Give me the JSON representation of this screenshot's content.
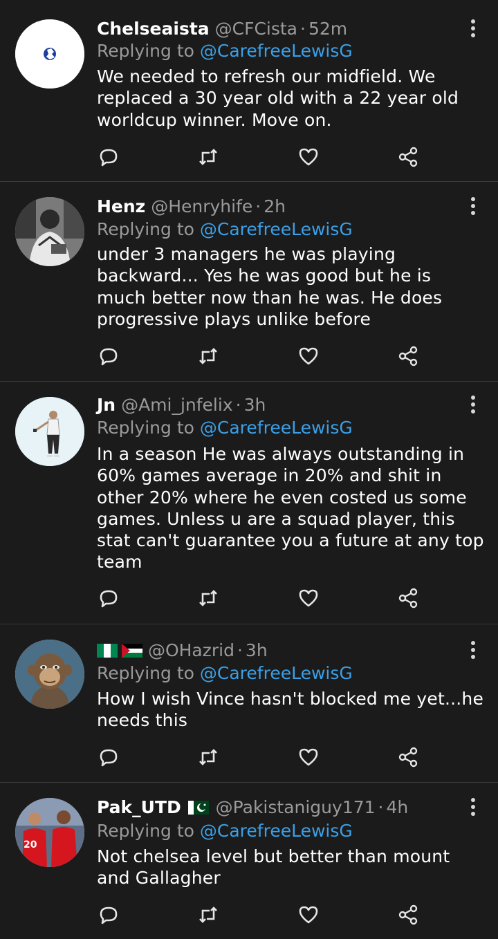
{
  "reply_prefix": "Replying to",
  "tweets": [
    {
      "name": "Chelseaista",
      "handle": "@CFCista",
      "time": "52m",
      "replying_to": "@CarefreeLewisG",
      "text": "We needed to refresh our midfield. We replaced a 30 year old with a 22 year old worldcup winner. Move on.",
      "avatar": "chelsea-crest"
    },
    {
      "name": "Henz",
      "handle": "@Henryhife",
      "time": "2h",
      "replying_to": "@CarefreeLewisG",
      "text": "under 3 managers he was playing backward... Yes he was good but he is much better now than he was.  He does progressive plays unlike before",
      "avatar": "person-photo"
    },
    {
      "name": "Jn",
      "handle": "@Ami_jnfelix",
      "time": "3h",
      "replying_to": "@CarefreeLewisG",
      "text": "In a season He was always outstanding in 60% games average in 20% and shit in other 20% where he even costed us some games. Unless u are a squad player, this stat can't guarantee you a future at any top team",
      "avatar": "player-illustration"
    },
    {
      "name": "",
      "name_flags": [
        "nigeria-flag",
        "palestine-flag"
      ],
      "handle": "@OHazrid",
      "time": "3h",
      "replying_to": "@CarefreeLewisG",
      "text": "How I wish Vince hasn't blocked me yet...he needs this",
      "avatar": "ape-nft"
    },
    {
      "name": "Pak_UTD",
      "name_flags": [
        "pakistan-flag"
      ],
      "handle": "@Pakistaniguy171",
      "time": "4h",
      "replying_to": "@CarefreeLewisG",
      "text": "Not chelsea level but better than mount and Gallagher",
      "avatar": "players-photo"
    }
  ],
  "icons": {
    "more": "more-vertical-icon",
    "reply": "reply-icon",
    "retweet": "retweet-icon",
    "like": "heart-icon",
    "share": "share-icon"
  },
  "colors": {
    "background": "#1b1b1b",
    "text": "#ffffff",
    "muted": "#9a9a9a",
    "mention": "#3aa0e8",
    "divider": "#3a3a3a"
  }
}
